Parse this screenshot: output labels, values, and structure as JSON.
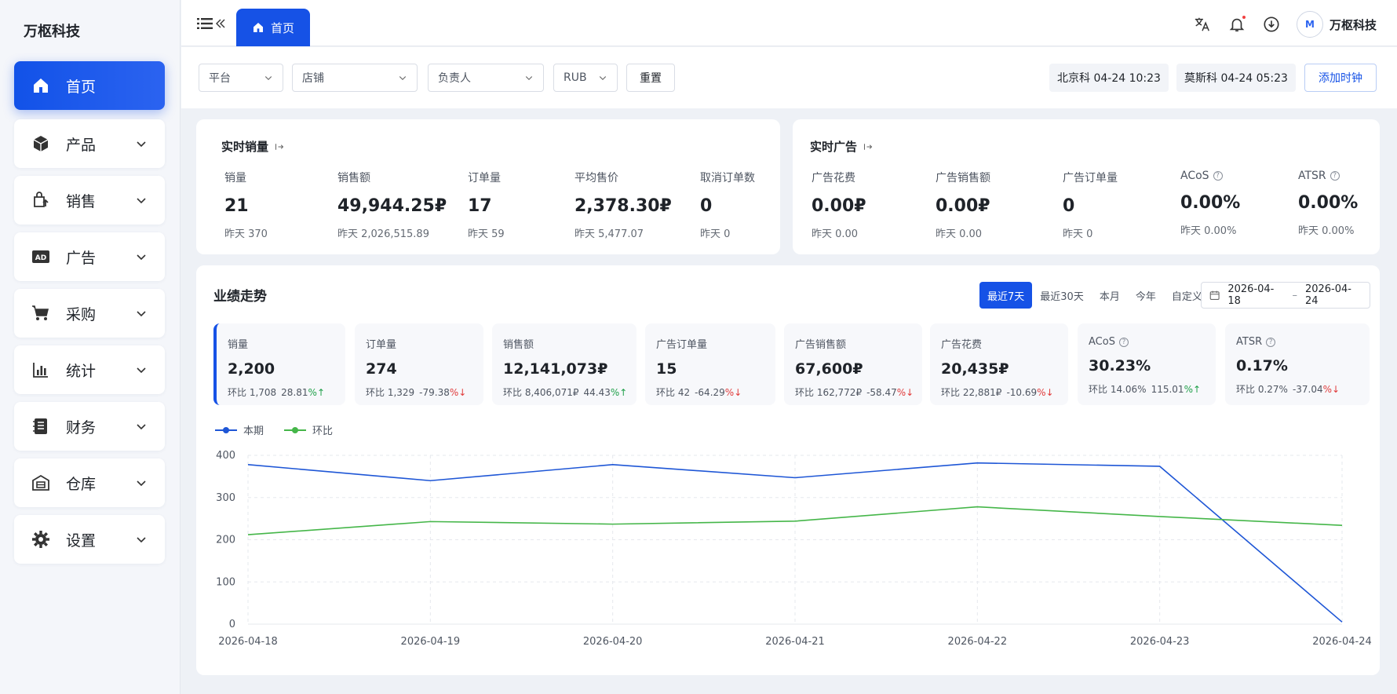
{
  "brand": "万枢科技",
  "sidebar": {
    "items": [
      {
        "label": "首页",
        "icon": "home-icon",
        "active": true
      },
      {
        "label": "产品",
        "icon": "cube-icon"
      },
      {
        "label": "销售",
        "icon": "shopping-bag-icon"
      },
      {
        "label": "广告",
        "icon": "ad-icon"
      },
      {
        "label": "采购",
        "icon": "cart-icon"
      },
      {
        "label": "统计",
        "icon": "bar-chart-icon"
      },
      {
        "label": "财务",
        "icon": "ledger-icon"
      },
      {
        "label": "仓库",
        "icon": "warehouse-icon"
      },
      {
        "label": "设置",
        "icon": "gear-icon"
      }
    ]
  },
  "topbar": {
    "tab_label": "首页",
    "user_name": "万枢科技",
    "avatar_text": "M"
  },
  "filters": {
    "platform": "平台",
    "store": "店铺",
    "owner": "负责人",
    "currency": "RUB",
    "reset": "重置",
    "clock_beijing": "北京科 04-24 10:23",
    "clock_moscow": "莫斯科 04-24 05:23",
    "add_clock": "添加时钟"
  },
  "realtime_sales": {
    "title": "实时销量",
    "metrics": [
      {
        "label": "销量",
        "value": "21",
        "yesterday": "昨天 370"
      },
      {
        "label": "销售额",
        "value": "49,944.25₽",
        "yesterday": "昨天 2,026,515.89"
      },
      {
        "label": "订单量",
        "value": "17",
        "yesterday": "昨天 59"
      },
      {
        "label": "平均售价",
        "value": "2,378.30₽",
        "yesterday": "昨天 5,477.07"
      },
      {
        "label": "取消订单数",
        "value": "0",
        "yesterday": "昨天 0"
      }
    ]
  },
  "realtime_ads": {
    "title": "实时广告",
    "metrics": [
      {
        "label": "广告花费",
        "value": "0.00₽",
        "yesterday": "昨天 0.00"
      },
      {
        "label": "广告销售额",
        "value": "0.00₽",
        "yesterday": "昨天 0.00"
      },
      {
        "label": "广告订单量",
        "value": "0",
        "yesterday": "昨天 0"
      },
      {
        "label": "ACoS",
        "value": "0.00%",
        "yesterday": "昨天 0.00%"
      },
      {
        "label": "ATSR",
        "value": "0.00%",
        "yesterday": "昨天 0.00%"
      }
    ]
  },
  "trend": {
    "title": "业绩走势",
    "ranges": [
      "最近7天",
      "最近30天",
      "本月",
      "今年",
      "自定义"
    ],
    "date_start": "2026-04-18",
    "date_sep": "–",
    "date_end": "2026-04-24",
    "kpis": [
      {
        "label": "销量",
        "value": "2,200",
        "prev": "环比 1,708",
        "pct": "28.81",
        "dir": "up"
      },
      {
        "label": "订单量",
        "value": "274",
        "prev": "环比 1,329",
        "pct": "-79.38",
        "dir": "down"
      },
      {
        "label": "销售额",
        "value": "12,141,073₽",
        "prev": "环比 8,406,071₽",
        "pct": "44.43",
        "dir": "up"
      },
      {
        "label": "广告订单量",
        "value": "15",
        "prev": "环比 42",
        "pct": "-64.29",
        "dir": "down"
      },
      {
        "label": "广告销售额",
        "value": "67,600₽",
        "prev": "环比 162,772₽",
        "pct": "-58.47",
        "dir": "down"
      },
      {
        "label": "广告花费",
        "value": "20,435₽",
        "prev": "环比 22,881₽",
        "pct": "-10.69",
        "dir": "down"
      },
      {
        "label": "ACoS",
        "value": "30.23%",
        "prev": "环比 14.06%",
        "pct": "115.01",
        "dir": "up"
      },
      {
        "label": "ATSR",
        "value": "0.17%",
        "prev": "环比 0.27%",
        "pct": "-37.04",
        "dir": "down"
      }
    ],
    "pct_sign": "%",
    "arrow_up": "↑",
    "arrow_down": "↓"
  },
  "chart_data": {
    "type": "line",
    "x": [
      "2026-04-18",
      "2026-04-19",
      "2026-04-20",
      "2026-04-21",
      "2026-04-22",
      "2026-04-23",
      "2026-04-24"
    ],
    "series": [
      {
        "name": "本期",
        "color": "#1e56d6",
        "values": [
          378,
          340,
          378,
          347,
          382,
          374,
          5
        ]
      },
      {
        "name": "环比",
        "color": "#45b649",
        "values": [
          212,
          243,
          237,
          244,
          278,
          255,
          234
        ]
      }
    ],
    "yticks": [
      0,
      100,
      200,
      300,
      400
    ],
    "ylim": [
      0,
      400
    ],
    "grid": true,
    "legend_position": "top-left"
  }
}
